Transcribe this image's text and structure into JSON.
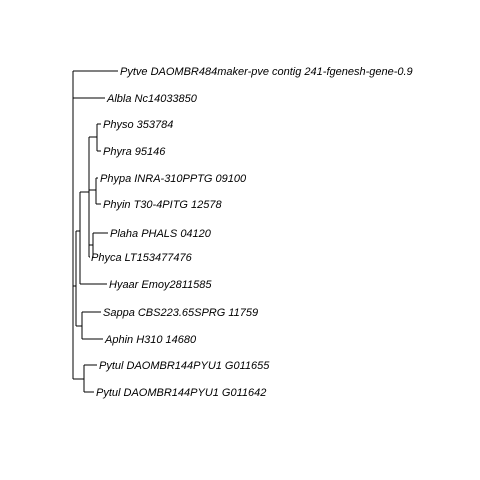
{
  "tree": {
    "leaves": [
      {
        "id": "pytve",
        "label": "Pytve DAOMBR484maker-pve contig 241-fgenesh-gene-0.9"
      },
      {
        "id": "albla",
        "label": "Albla Nc14033850"
      },
      {
        "id": "physo",
        "label": "Physo 353784"
      },
      {
        "id": "phyra",
        "label": "Phyra 95146"
      },
      {
        "id": "phypa",
        "label": "Phypa INRA-310PPTG 09100"
      },
      {
        "id": "phyin",
        "label": "Phyin T30-4PITG 12578"
      },
      {
        "id": "plaha",
        "label": "Plaha PHALS 04120"
      },
      {
        "id": "phyca",
        "label": "Phyca LT153477476"
      },
      {
        "id": "hyaar",
        "label": "Hyaar Emoy2811585"
      },
      {
        "id": "sappa",
        "label": "Sappa CBS223.65SPRG 11759"
      },
      {
        "id": "aphin",
        "label": "Aphin H310 14680"
      },
      {
        "id": "pytul1",
        "label": "Pytul DAOMBR144PYU1 G011655"
      },
      {
        "id": "pytul2",
        "label": "Pytul DAOMBR144PYU1 G011642"
      }
    ]
  }
}
